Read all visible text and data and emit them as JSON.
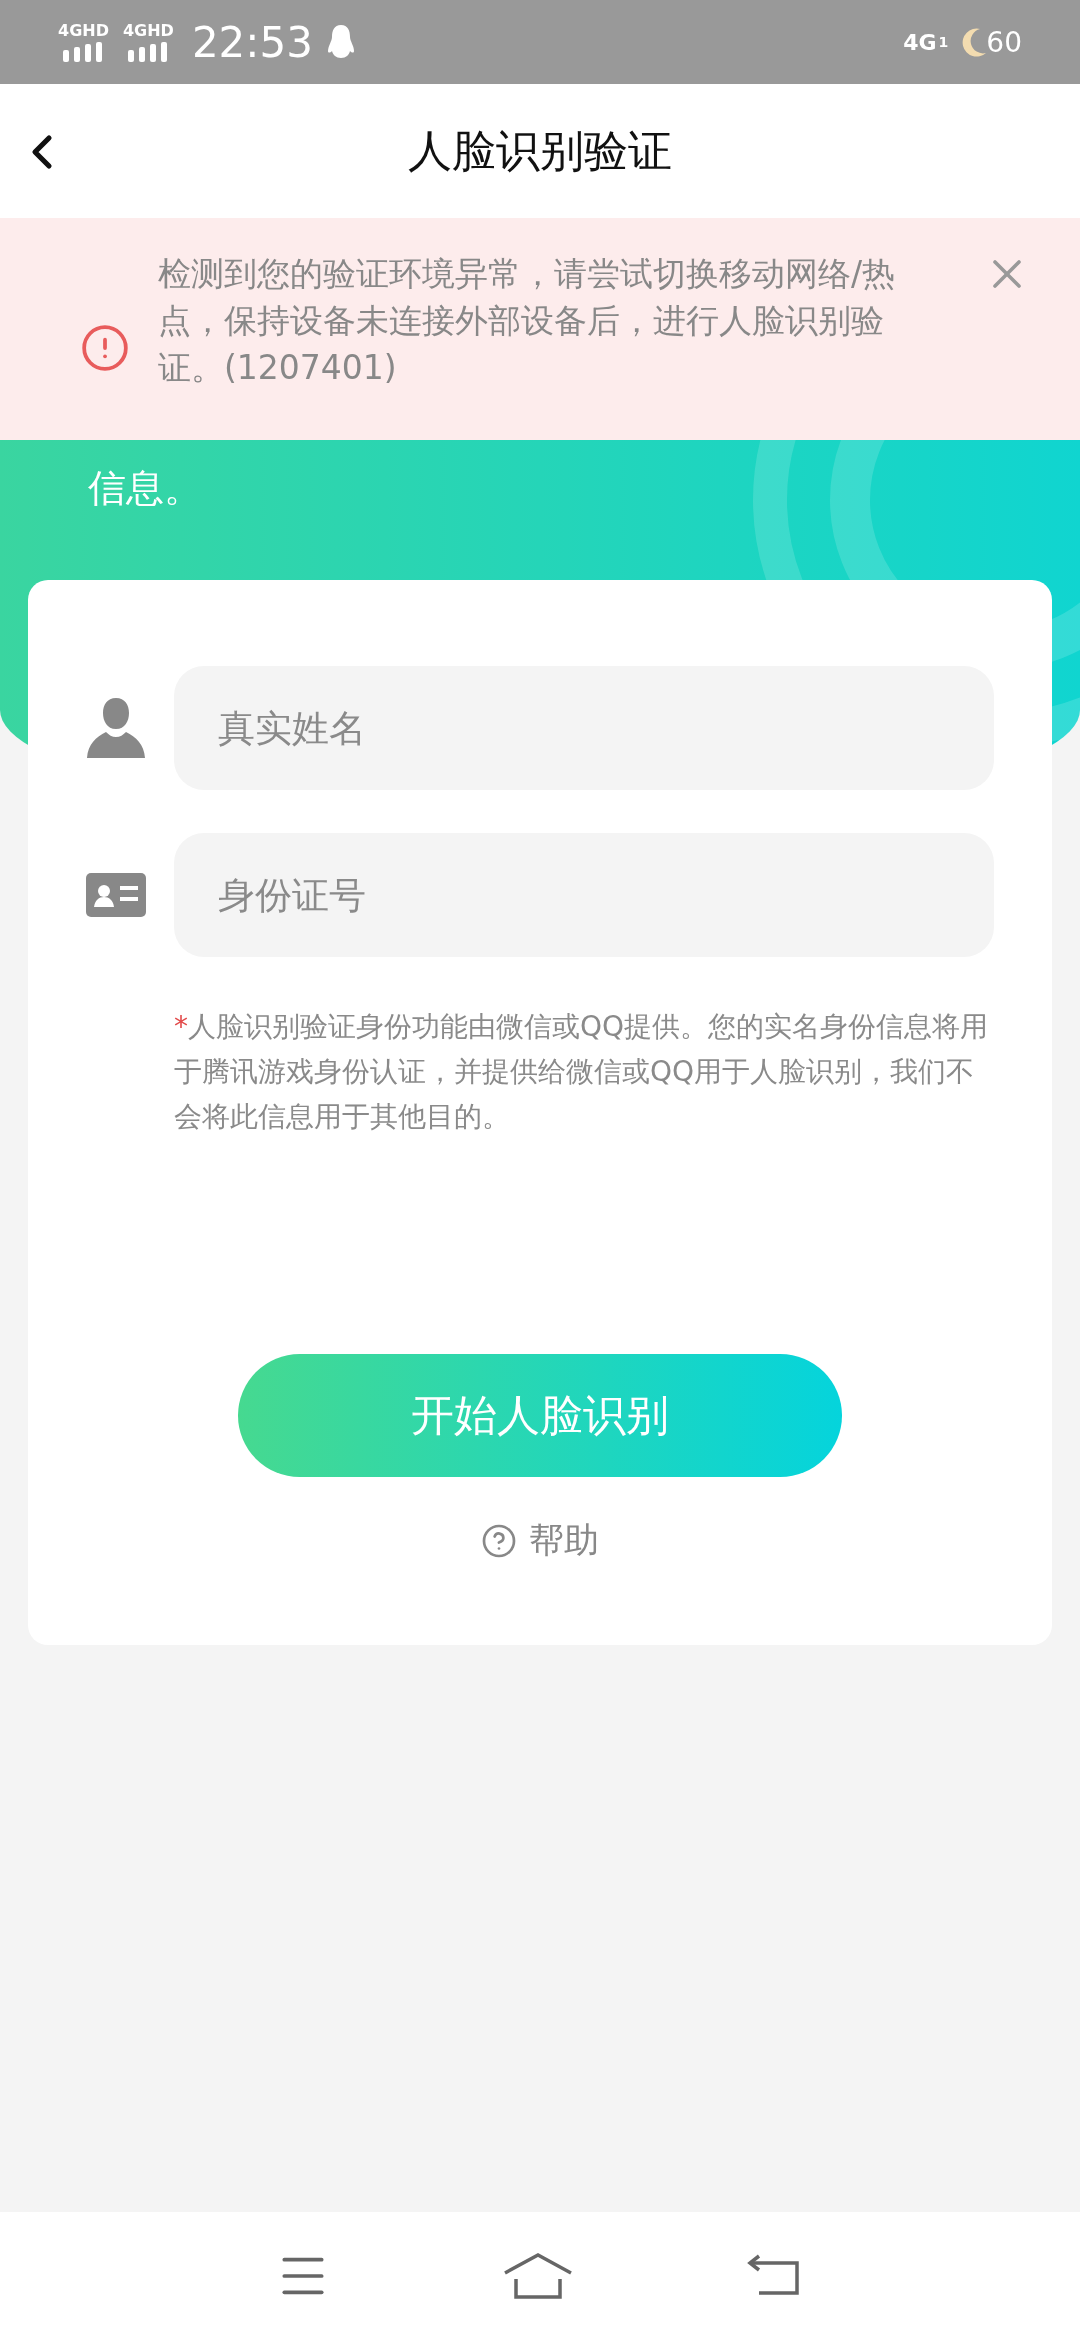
{
  "status_bar": {
    "signals": [
      "4GHD",
      "4GHD"
    ],
    "time": "22:53",
    "network": "4G",
    "sim": "1",
    "battery": "60"
  },
  "header": {
    "title": "人脸识别验证"
  },
  "alert": {
    "message": "检测到您的验证环境异常，请尝试切换移动网络/热点，保持设备未连接外部设备后，进行人脸识别验证。(1207401)"
  },
  "intro_fragment": "信息。",
  "form": {
    "fields": [
      {
        "kind": "person",
        "placeholder": "真实姓名"
      },
      {
        "kind": "id-card",
        "placeholder": "身份证号"
      }
    ],
    "note_mark": "*",
    "note": "人脸识别验证身份功能由微信或QQ提供。您的实名身份信息将用于腾讯游戏身份认证，并提供给微信或QQ用于人脸识别，我们不会将此信息用于其他目的。",
    "submit": "开始人脸识别",
    "help": "帮助"
  },
  "nav_bar": [
    {
      "kind": "menu"
    },
    {
      "kind": "home"
    },
    {
      "kind": "back"
    }
  ]
}
